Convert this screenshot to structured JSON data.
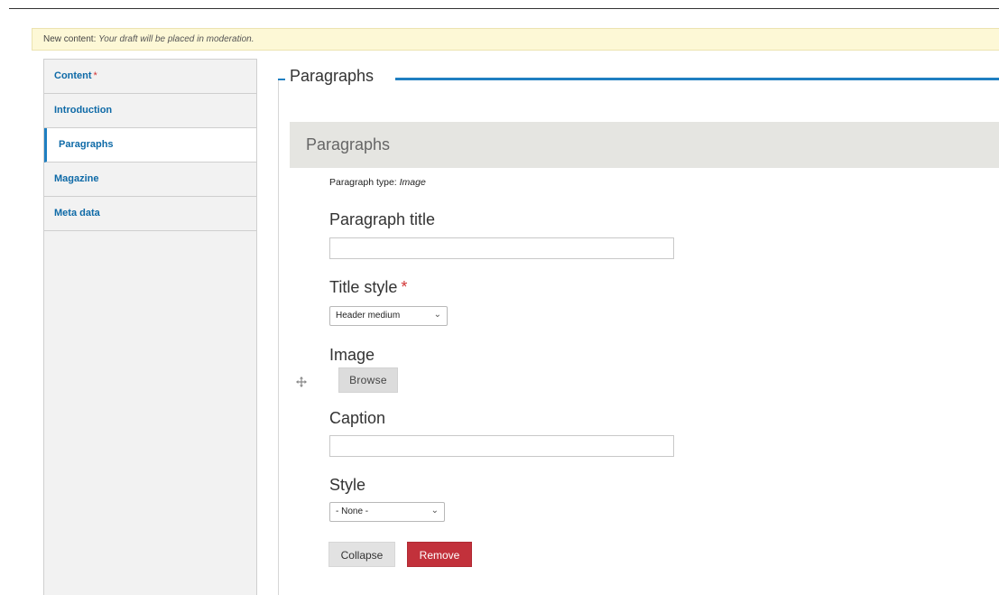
{
  "notice": {
    "prefix": "New content:",
    "message": "Your draft will be placed in moderation."
  },
  "tabs": [
    {
      "label": "Content",
      "required": true,
      "active": false
    },
    {
      "label": "Introduction",
      "required": false,
      "active": false
    },
    {
      "label": "Paragraphs",
      "required": false,
      "active": true
    },
    {
      "label": "Magazine",
      "required": false,
      "active": false
    },
    {
      "label": "Meta data",
      "required": false,
      "active": false
    }
  ],
  "required_marker": "*",
  "fieldset": {
    "legend": "Paragraphs"
  },
  "paragraph": {
    "header": "Paragraphs",
    "type_prefix": "Paragraph type:",
    "type_value": "Image",
    "drag_icon": "drag-handle-icon",
    "title_label": "Paragraph title",
    "title_value": "",
    "title_style_label": "Title style",
    "title_style_selected": "Header medium",
    "image_label": "Image",
    "browse_label": "Browse",
    "caption_label": "Caption",
    "caption_value": "",
    "style_label": "Style",
    "style_selected": "- None -",
    "collapse_label": "Collapse",
    "remove_label": "Remove"
  },
  "colors": {
    "accent": "#1f7fc1",
    "link": "#0e6aa7",
    "danger": "#c2313b",
    "required": "#d23535",
    "notice_bg": "#fdf8d6"
  }
}
